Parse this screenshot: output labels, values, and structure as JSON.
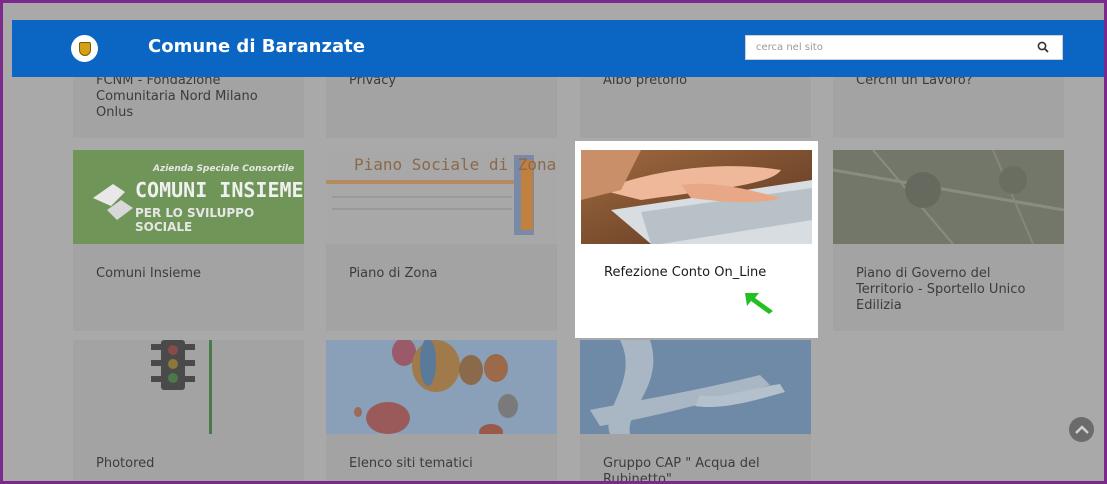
{
  "header": {
    "site_title": "Comune di Baranzate",
    "search_placeholder": "cerca nel sito",
    "brand_color": "#0a66c2"
  },
  "cards": [
    {
      "label": "FCNM - Fondazione Comunitaria Nord Milano Onlus"
    },
    {
      "label": "Privacy"
    },
    {
      "label": "Albo pretorio"
    },
    {
      "label": "Cerchi un Lavoro?"
    },
    {
      "label": "Comuni Insieme",
      "logo_line1": "Azienda Speciale Consortile",
      "logo_line2": "COMUNI INSIEME",
      "logo_line3": "PER LO SVILUPPO SOCIALE"
    },
    {
      "label": "Piano di Zona",
      "logo_title": "Piano Sociale di Zona"
    },
    {
      "label": "Refezione Conto On_Line"
    },
    {
      "label": "Piano di Governo del Territorio - Sportello Unico Edilizia"
    },
    {
      "label": "Photored"
    },
    {
      "label": "Elenco siti tematici"
    },
    {
      "label": "Gruppo CAP \" Acqua del Rubinetto\""
    }
  ],
  "icons": {
    "search": "search-icon",
    "scroll_top": "chevron-up-icon",
    "cursor": "green-arrow-cursor"
  }
}
